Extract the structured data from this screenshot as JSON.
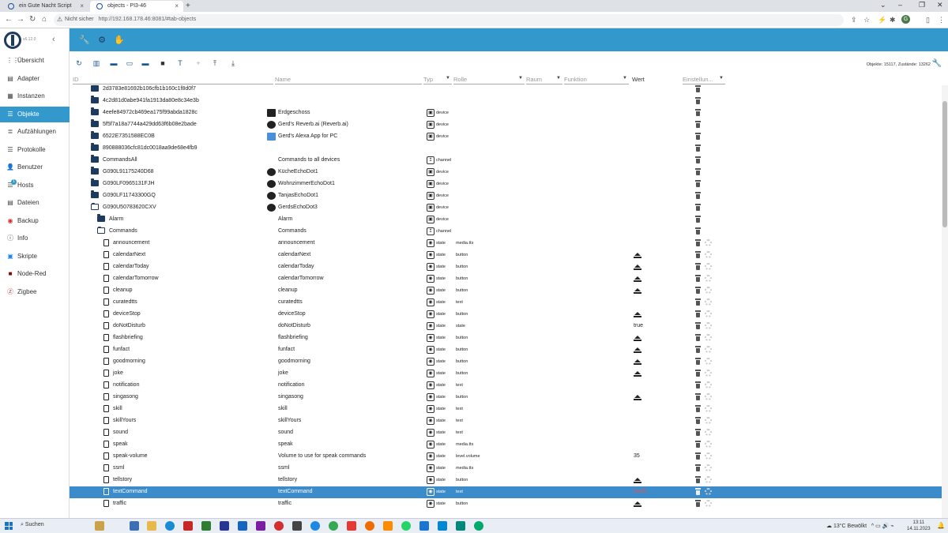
{
  "browser": {
    "tabs": [
      {
        "label": "ein Gute Nacht Script"
      },
      {
        "label": "objects - PI3-46"
      }
    ],
    "security_label": "Nicht sicher",
    "url": "http://192.168.178.46:8081/#tab-objects"
  },
  "app": {
    "version": "v6.12.0",
    "counts_label": "Objekte: 15117, Zustände: 13262"
  },
  "sidebar": {
    "items": [
      {
        "label": "Übersicht",
        "icon": "grid-icon"
      },
      {
        "label": "Adapter",
        "icon": "adapter-icon"
      },
      {
        "label": "Instanzen",
        "icon": "instances-icon"
      },
      {
        "label": "Objekte",
        "icon": "objects-icon",
        "active": true
      },
      {
        "label": "Aufzählungen",
        "icon": "enums-icon"
      },
      {
        "label": "Protokolle",
        "icon": "logs-icon"
      },
      {
        "label": "Benutzer",
        "icon": "user-icon"
      },
      {
        "label": "Hosts",
        "icon": "hosts-icon",
        "badge": "1"
      },
      {
        "label": "Dateien",
        "icon": "files-icon"
      },
      {
        "label": "Backup",
        "icon": "backup-icon"
      },
      {
        "label": "Info",
        "icon": "info-icon"
      },
      {
        "label": "Skripte",
        "icon": "scripts-icon"
      },
      {
        "label": "Node-Red",
        "icon": "nodered-icon"
      },
      {
        "label": "Zigbee",
        "icon": "zigbee-icon"
      }
    ]
  },
  "columns": {
    "id": "ID",
    "name": "Name",
    "type": "Typ",
    "role": "Rolle",
    "room": "Raum",
    "function": "Funktion",
    "value": "Wert",
    "settings": "Einstellun..."
  },
  "rows": [
    {
      "id": "2d3783e81692b106cfb1b160c1f8d0f7",
      "level": 0,
      "kind": "folder"
    },
    {
      "id": "4c2d81d0abe941fa1913da80e8c34e3b",
      "level": 0,
      "kind": "folder"
    },
    {
      "id": "4eefe84972cb469ea175f99abda1828c",
      "level": 0,
      "kind": "folder",
      "name": "Erdgeschoss",
      "type": "device"
    },
    {
      "id": "5f5f7a18a7744a429dd63f6b08e2bade",
      "level": 0,
      "kind": "folder",
      "name": "Gerd's Reverb.ai (Reverb.ai)",
      "type": "device"
    },
    {
      "id": "6522E7351588EC0B",
      "level": 0,
      "kind": "folder",
      "name": "Gerd's Alexa App for PC",
      "type": "device"
    },
    {
      "id": "890888036cfc81dc0018aa9de68e4fb9",
      "level": 0,
      "kind": "folder"
    },
    {
      "id": "CommandsAll",
      "level": 0,
      "kind": "folder",
      "name": "Commands to all devices",
      "type": "channel"
    },
    {
      "id": "G090L91175240D68",
      "level": 0,
      "kind": "folder",
      "name": "KücheEchoDot1",
      "type": "device"
    },
    {
      "id": "G090LF0965131FJH",
      "level": 0,
      "kind": "folder",
      "name": "WohnzimmerEchoDot1",
      "type": "device"
    },
    {
      "id": "G090LF11743300GQ",
      "level": 0,
      "kind": "folder",
      "name": "TanjasEchoDot1",
      "type": "device"
    },
    {
      "id": "G090U50783620CXV",
      "level": 0,
      "kind": "folder-open",
      "name": "GerdsEchoDot3",
      "type": "device"
    },
    {
      "id": "Alarm",
      "level": 1,
      "kind": "folder",
      "name": "Alarm",
      "type": "device"
    },
    {
      "id": "Commands",
      "level": 1,
      "kind": "folder-open",
      "name": "Commands",
      "type": "channel"
    },
    {
      "id": "announcement",
      "level": 2,
      "kind": "file",
      "name": "announcement",
      "type": "state",
      "role": "media.tts"
    },
    {
      "id": "calendarNext",
      "level": 2,
      "kind": "file",
      "name": "calendarNext",
      "type": "state",
      "role": "button",
      "value_push": true
    },
    {
      "id": "calendarToday",
      "level": 2,
      "kind": "file",
      "name": "calendarToday",
      "type": "state",
      "role": "button",
      "value_push": true
    },
    {
      "id": "calendarTomorrow",
      "level": 2,
      "kind": "file",
      "name": "calendarTomorrow",
      "type": "state",
      "role": "button",
      "value_push": true
    },
    {
      "id": "cleanup",
      "level": 2,
      "kind": "file",
      "name": "cleanup",
      "type": "state",
      "role": "button",
      "value_push": true
    },
    {
      "id": "curatedtts",
      "level": 2,
      "kind": "file",
      "name": "curatedtts",
      "type": "state",
      "role": "text"
    },
    {
      "id": "deviceStop",
      "level": 2,
      "kind": "file",
      "name": "deviceStop",
      "type": "state",
      "role": "button",
      "value_push": true
    },
    {
      "id": "doNotDisturb",
      "level": 2,
      "kind": "file",
      "name": "doNotDisturb",
      "type": "state",
      "role": "state",
      "value": "true"
    },
    {
      "id": "flashbriefing",
      "level": 2,
      "kind": "file",
      "name": "flashbriefing",
      "type": "state",
      "role": "button",
      "value_push": true
    },
    {
      "id": "funfact",
      "level": 2,
      "kind": "file",
      "name": "funfact",
      "type": "state",
      "role": "button",
      "value_push": true
    },
    {
      "id": "goodmorning",
      "level": 2,
      "kind": "file",
      "name": "goodmorning",
      "type": "state",
      "role": "button",
      "value_push": true
    },
    {
      "id": "joke",
      "level": 2,
      "kind": "file",
      "name": "joke",
      "type": "state",
      "role": "button",
      "value_push": true
    },
    {
      "id": "notification",
      "level": 2,
      "kind": "file",
      "name": "notification",
      "type": "state",
      "role": "text"
    },
    {
      "id": "singasong",
      "level": 2,
      "kind": "file",
      "name": "singasong",
      "type": "state",
      "role": "button",
      "value_push": true
    },
    {
      "id": "skill",
      "level": 2,
      "kind": "file",
      "name": "skill",
      "type": "state",
      "role": "text"
    },
    {
      "id": "skillYours",
      "level": 2,
      "kind": "file",
      "name": "skillYours",
      "type": "state",
      "role": "text"
    },
    {
      "id": "sound",
      "level": 2,
      "kind": "file",
      "name": "sound",
      "type": "state",
      "role": "text"
    },
    {
      "id": "speak",
      "level": 2,
      "kind": "file",
      "name": "speak",
      "type": "state",
      "role": "media.tts"
    },
    {
      "id": "speak-volume",
      "level": 2,
      "kind": "file",
      "name": "Volume to use for speak commands",
      "type": "state",
      "role": "level.volume",
      "value": "35"
    },
    {
      "id": "ssml",
      "level": 2,
      "kind": "file",
      "name": "ssml",
      "type": "state",
      "role": "media.tts"
    },
    {
      "id": "tellstory",
      "level": 2,
      "kind": "file",
      "name": "tellstory",
      "type": "state",
      "role": "button",
      "value_push": true
    },
    {
      "id": "textCommand",
      "level": 2,
      "kind": "file",
      "name": "textCommand",
      "type": "state",
      "role": "text",
      "selected": true,
      "value": "(null)",
      "value_err": true
    },
    {
      "id": "traffic",
      "level": 2,
      "kind": "file",
      "name": "traffic",
      "type": "state",
      "role": "button",
      "value_push": true
    }
  ],
  "taskbar": {
    "search_label": "Suchen",
    "weather": "13°C Bewölkt",
    "time": "13:11",
    "date": "14.11.2023"
  }
}
